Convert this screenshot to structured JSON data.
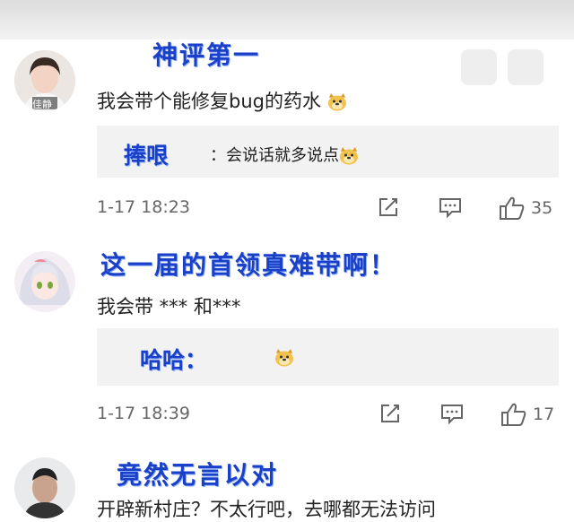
{
  "comments": [
    {
      "caption": "神评第一",
      "text": "我会带个能修复bug的药水",
      "text_emoji": "doge-emoji",
      "avatar_label": "佳静",
      "reply": {
        "name": "捧哏",
        "text": "会说话就多说点",
        "emoji": "doge-emoji"
      },
      "time": "1-17 18:23",
      "likes": "35"
    },
    {
      "caption": "这一届的首领真难带啊！",
      "text": "我会带 *** 和***",
      "reply": {
        "name": "哈哈：",
        "text": "",
        "emoji": "doge-emoji"
      },
      "time": "1-17 18:39",
      "likes": "17"
    },
    {
      "caption": "竟然无言以对",
      "text": "开辟新村庄？不太行吧，去哪都无法访问"
    }
  ],
  "icons": [
    "edit-icon",
    "comment-icon",
    "thumbs-up-icon"
  ],
  "colors": {
    "caption": "#1a40c8",
    "reply_bg": "#f2f2f2",
    "meta": "#666666"
  }
}
